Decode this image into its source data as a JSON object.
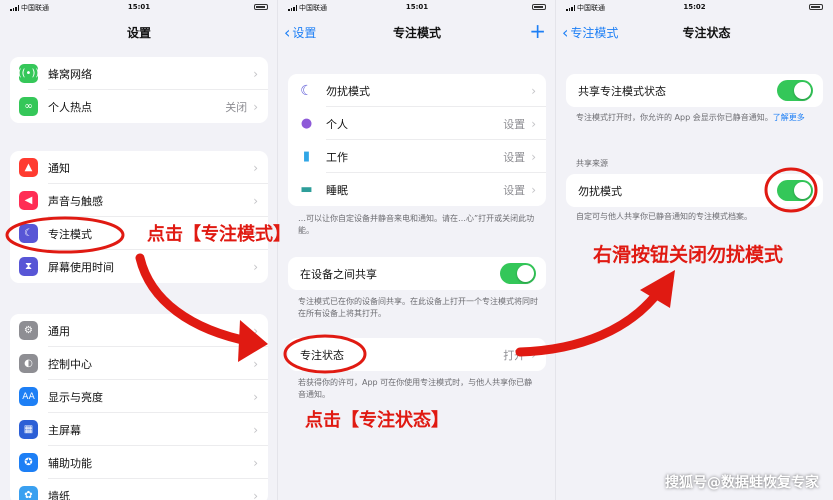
{
  "status_bars": [
    {
      "carrier": "中国联通",
      "time": "15:01"
    },
    {
      "carrier": "中国联通",
      "time": "15:01"
    },
    {
      "carrier": "中国联通",
      "time": "15:02"
    }
  ],
  "panel1": {
    "title": "设置",
    "group1": [
      {
        "label": "蜂窝网络",
        "icon": "cellular-icon",
        "color": "#35c759",
        "value": ""
      },
      {
        "label": "个人热点",
        "icon": "hotspot-icon",
        "color": "#35c759",
        "value": "关闭"
      }
    ],
    "group2": [
      {
        "label": "通知",
        "icon": "bell-icon",
        "color": "#ff3b30",
        "value": ""
      },
      {
        "label": "声音与触感",
        "icon": "speaker-icon",
        "color": "#ff2d55",
        "value": ""
      },
      {
        "label": "专注模式",
        "icon": "moon-icon",
        "color": "#5856d6",
        "value": ""
      },
      {
        "label": "屏幕使用时间",
        "icon": "hourglass-icon",
        "color": "#5856d6",
        "value": ""
      }
    ],
    "group3": [
      {
        "label": "通用",
        "icon": "gear-icon",
        "color": "#8e8e93",
        "value": ""
      },
      {
        "label": "控制中心",
        "icon": "switches-icon",
        "color": "#8e8e93",
        "value": ""
      },
      {
        "label": "显示与亮度",
        "icon": "aa-icon",
        "color": "#1d7ff5",
        "value": ""
      },
      {
        "label": "主屏幕",
        "icon": "grid-icon",
        "color": "#2c5fd6",
        "value": ""
      },
      {
        "label": "辅助功能",
        "icon": "accessibility-icon",
        "color": "#1d7ff5",
        "value": ""
      },
      {
        "label": "墙纸",
        "icon": "wallpaper-icon",
        "color": "#3aa0f0",
        "value": ""
      }
    ]
  },
  "panel2": {
    "back": "设置",
    "title": "专注模式",
    "modes": [
      {
        "label": "勿扰模式",
        "icon": "moon-icon",
        "color": "#5856d6",
        "value": ""
      },
      {
        "label": "个人",
        "icon": "person-icon",
        "color": "#8e5ad8",
        "value": "设置"
      },
      {
        "label": "工作",
        "icon": "badge-icon",
        "color": "#30a6e6",
        "value": "设置"
      },
      {
        "label": "睡眠",
        "icon": "bed-icon",
        "color": "#2e9e9a",
        "value": "设置"
      }
    ],
    "modes_note": "…可以让你自定设备并静音来电和通知。请在…心”打开或关闭此功能。",
    "share_label": "在设备之间共享",
    "share_note": "专注模式已在你的设备间共享。在此设备上打开一个专注模式将同时在所有设备上将其打开。",
    "status_label": "专注状态",
    "status_value": "打开",
    "status_note": "若获得你的许可，App 可在你使用专注模式时，与他人共享你已静音通知。"
  },
  "panel3": {
    "back": "专注模式",
    "title": "专注状态",
    "share_label": "共享专注模式状态",
    "share_note_pre": "专注模式打开时，你允许的 App 会显示你已静音通知。",
    "share_note_link": "了解更多",
    "section_header": "共享来源",
    "dnd_label": "勿扰模式",
    "dnd_note": "自定可与他人共享你已静音通知的专注模式档案。"
  },
  "annotations": {
    "a1": "点击【专注模式】",
    "a2": "点击【专注状态】",
    "a3": "右滑按钮关闭勿扰模式"
  },
  "watermark": "搜狐号@数据蛙恢复专家",
  "accent_color": "#1d7ff5",
  "annotation_color": "#e01a12"
}
